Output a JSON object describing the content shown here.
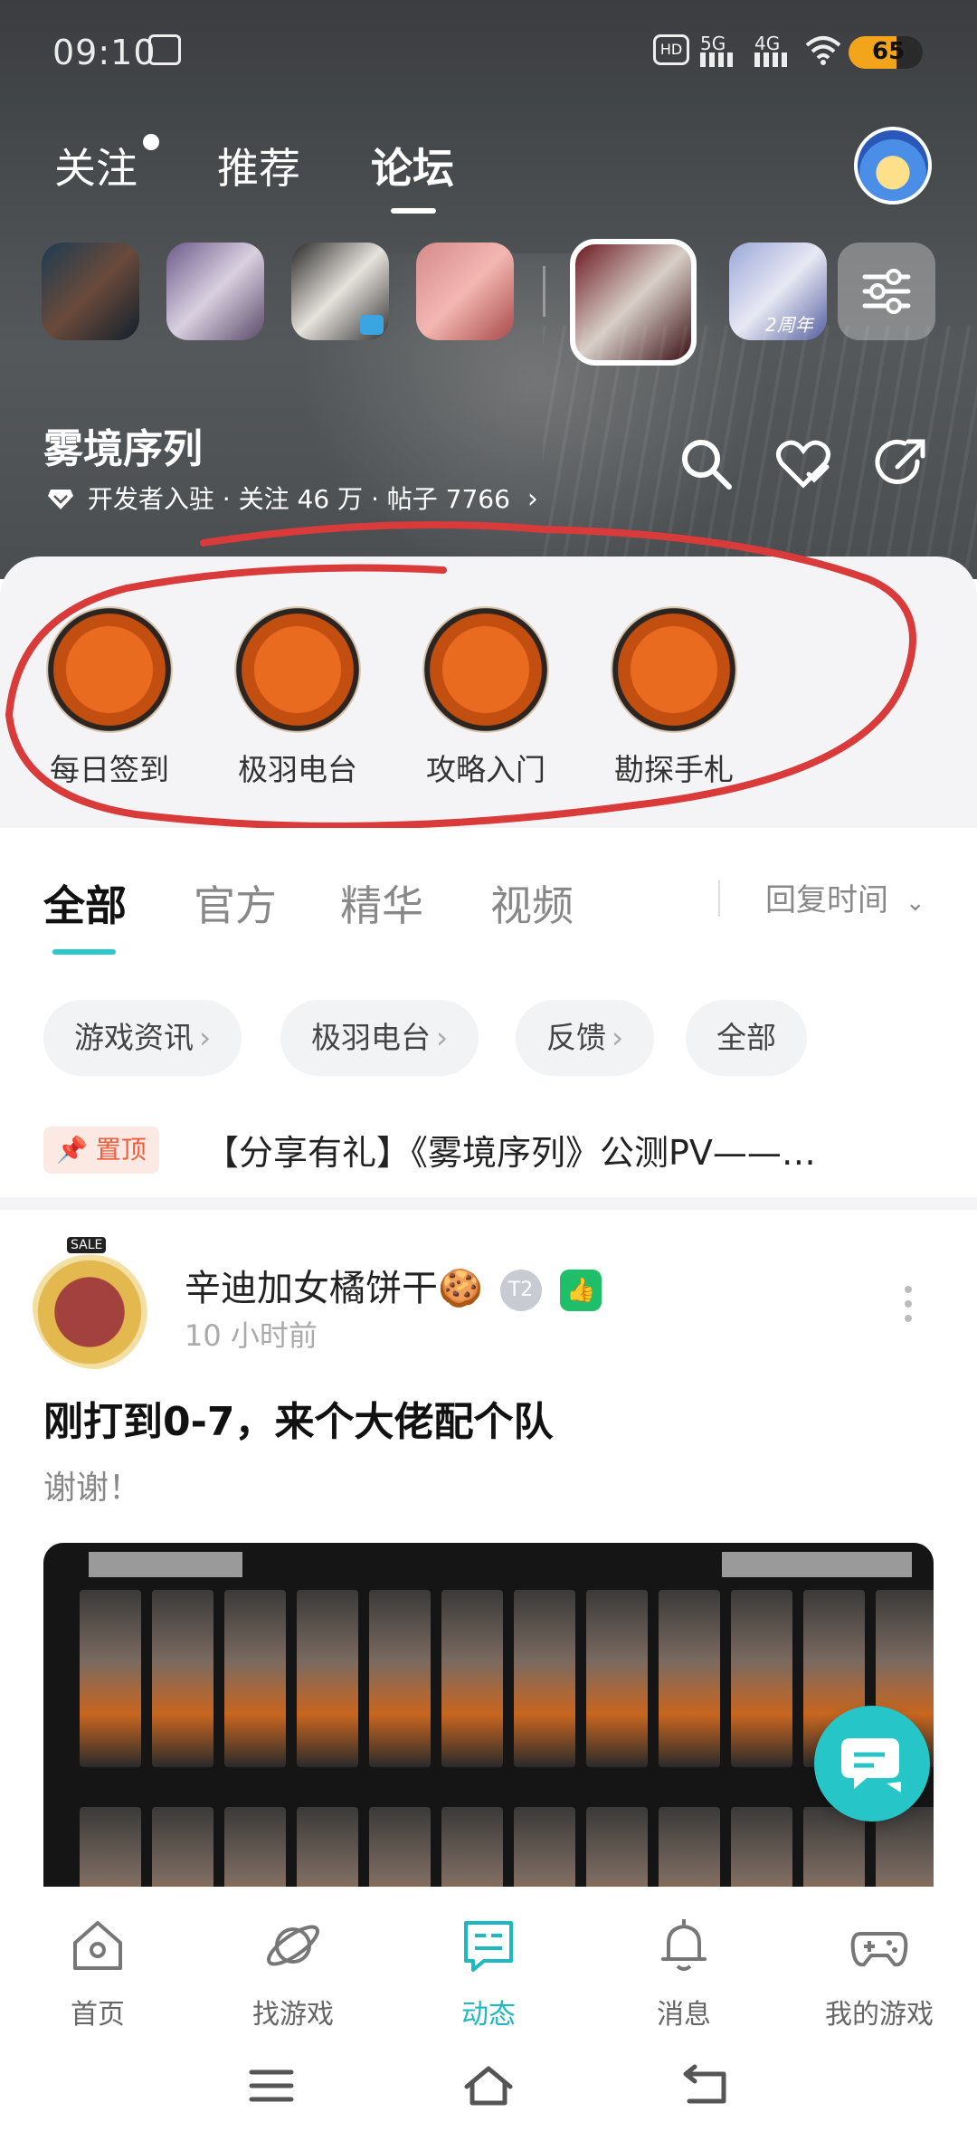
{
  "status_bar": {
    "time": "09:10",
    "network_1": "5G",
    "network_2": "4G",
    "battery": "65",
    "battery_level": 0.65
  },
  "top_tabs": [
    {
      "label": "关注",
      "has_dot": true
    },
    {
      "label": "推荐"
    },
    {
      "label": "论坛",
      "active": true
    }
  ],
  "game_strip": {
    "icons": [
      "game-icon-1",
      "game-icon-2",
      "game-icon-3",
      "game-icon-4",
      "game-icon-selected",
      "game-icon-6"
    ],
    "badge_text": "2周年"
  },
  "game_header": {
    "name": "雾境序列",
    "meta": "开发者入驻 · 关注 46 万 · 帖子 7766"
  },
  "quick_actions": [
    {
      "label": "每日签到",
      "icon": "gift-box-icon"
    },
    {
      "label": "极羽电台",
      "icon": "radio-icon"
    },
    {
      "label": "攻略入门",
      "icon": "map-compass-icon"
    },
    {
      "label": "勘探手札",
      "icon": "notebook-icon"
    }
  ],
  "feed_tabs": {
    "items": [
      "全部",
      "官方",
      "精华",
      "视频"
    ],
    "active": "全部",
    "sort": "回复时间"
  },
  "chips": [
    "游戏资讯",
    "极羽电台",
    "反馈",
    "全部"
  ],
  "pinned": {
    "badge": "置顶",
    "text": "【分享有礼】《雾境序列》公测PV——…"
  },
  "post": {
    "author": "辛迪加女橘饼干🍪",
    "author_level": "T2",
    "time": "10 小时前",
    "avatar_badge": "SALE",
    "title": "刚打到0-7，来个大佬配个队",
    "body": "谢谢！"
  },
  "bottom_nav": [
    {
      "label": "首页",
      "icon": "home-icon"
    },
    {
      "label": "找游戏",
      "icon": "planet-icon"
    },
    {
      "label": "动态",
      "icon": "feed-icon",
      "active": true
    },
    {
      "label": "消息",
      "icon": "bell-icon"
    },
    {
      "label": "我的游戏",
      "icon": "gamepad-icon"
    }
  ],
  "colors": {
    "accent": "#26c6c8",
    "active_nav": "#20b8c0",
    "annotation_red": "#d93a3a",
    "pin_red": "#f25b3a"
  }
}
